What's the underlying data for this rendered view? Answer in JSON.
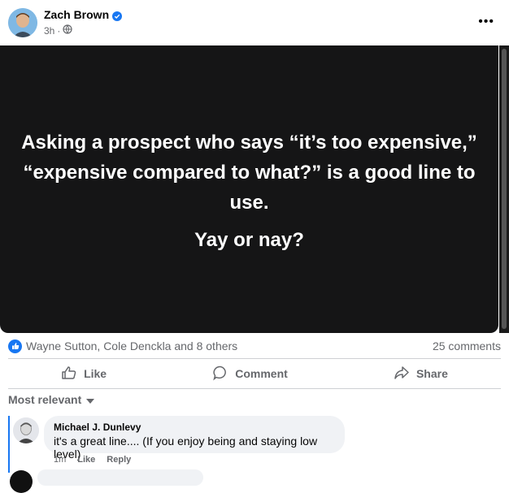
{
  "post": {
    "author": "Zach Brown",
    "time": "3h",
    "more_label": "•••",
    "text_main": "Asking a prospect who says “it’s too expensive,” “expensive compared to what?” is a good line to use.",
    "text_question": "Yay or nay?"
  },
  "reactions": {
    "summary": "Wayne Sutton, Cole Denckla and 8 others",
    "comments_count": "25 comments"
  },
  "actions": {
    "like": "Like",
    "comment": "Comment",
    "share": "Share"
  },
  "sort": {
    "label": "Most relevant"
  },
  "comments": [
    {
      "author": "Michael J. Dunlevy",
      "text": "it's a great line.... (If you enjoy being and staying low level)",
      "time": "1m",
      "like": "Like",
      "reply": "Reply"
    }
  ],
  "colors": {
    "accent": "#1877f2",
    "image_bg": "#151516",
    "muted_text": "#65676b",
    "bubble_bg": "#f0f2f5"
  },
  "icons": [
    "verified-icon",
    "globe-icon",
    "more-icon",
    "like-reaction-icon",
    "thumbs-up-icon",
    "comment-icon",
    "share-icon",
    "chevron-down-icon"
  ]
}
